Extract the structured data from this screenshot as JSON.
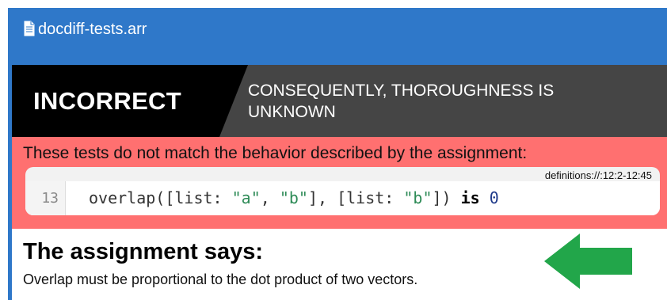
{
  "file": {
    "name": "docdiff-tests.arr",
    "icon": "document-icon"
  },
  "verdict": {
    "label": "INCORRECT",
    "subtitle": "CONSEQUENTLY, THOROUGHNESS IS UNKNOWN"
  },
  "error": {
    "message": "These tests do not match the behavior described by the assignment:",
    "location": "definitions://:12:2-12:45",
    "line_number": "13",
    "code": {
      "t1": "overlap([list: ",
      "s1": "\"a\"",
      "t2": ", ",
      "s2": "\"b\"",
      "t3": "], [list: ",
      "s3": "\"b\"",
      "t4": "]) ",
      "kw": "is",
      "t5": " ",
      "num": "0"
    }
  },
  "assignment": {
    "title": "The assignment says:",
    "text": "Overlap must be proportional to the dot product of two vectors."
  },
  "colors": {
    "header": "#2f78c9",
    "incorrect_bg": "#000000",
    "verdict_bg": "#454545",
    "error_bg": "#ff7070",
    "arrow": "#22a64a"
  },
  "annotation": {
    "icon": "left-arrow-icon"
  }
}
